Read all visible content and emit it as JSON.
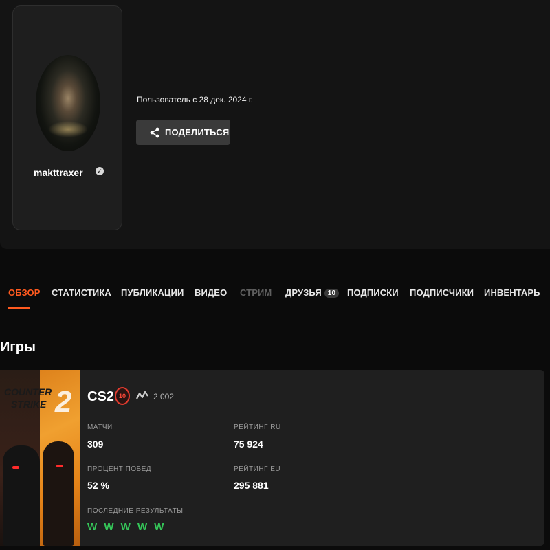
{
  "profile": {
    "username": "makttraxer",
    "member_since": "Пользователь с 28 дек. 2024 г.",
    "share_label": "ПОДЕЛИТЬСЯ"
  },
  "tabs": [
    {
      "label": "ОБЗОР",
      "state": "active"
    },
    {
      "label": "СТАТИСТИКА",
      "state": "normal"
    },
    {
      "label": "ПУБЛИКАЦИИ",
      "state": "normal"
    },
    {
      "label": "ВИДЕО",
      "state": "normal"
    },
    {
      "label": "СТРИМ",
      "state": "disabled"
    },
    {
      "label": "ДРУЗЬЯ",
      "state": "normal",
      "badge": "10"
    },
    {
      "label": "ПОДПИСКИ",
      "state": "normal"
    },
    {
      "label": "ПОДПИСЧИКИ",
      "state": "normal"
    },
    {
      "label": "ИНВЕНТАРЬ",
      "state": "normal"
    }
  ],
  "games_section": {
    "title": "Игры",
    "game": {
      "art_text_1": "COUNTER",
      "art_text_2": "STRIKE",
      "art_text_3": "2",
      "name": "CS2",
      "level": "10",
      "elo": "2 002",
      "stats": {
        "matches_label": "МАТЧИ",
        "matches_value": "309",
        "rating_ru_label": "РЕЙТИНГ RU",
        "rating_ru_value": "75 924",
        "winrate_label": "ПРОЦЕНТ ПОБЕД",
        "winrate_value": "52 %",
        "rating_eu_label": "РЕЙТИНГ EU",
        "rating_eu_value": "295 881",
        "recent_label": "ПОСЛЕДНИЕ РЕЗУЛЬТАТЫ",
        "recent_value": "W W W W W"
      }
    }
  },
  "colors": {
    "accent": "#ff5a1f",
    "win": "#35c759",
    "level_ring": "#e23b2e"
  }
}
